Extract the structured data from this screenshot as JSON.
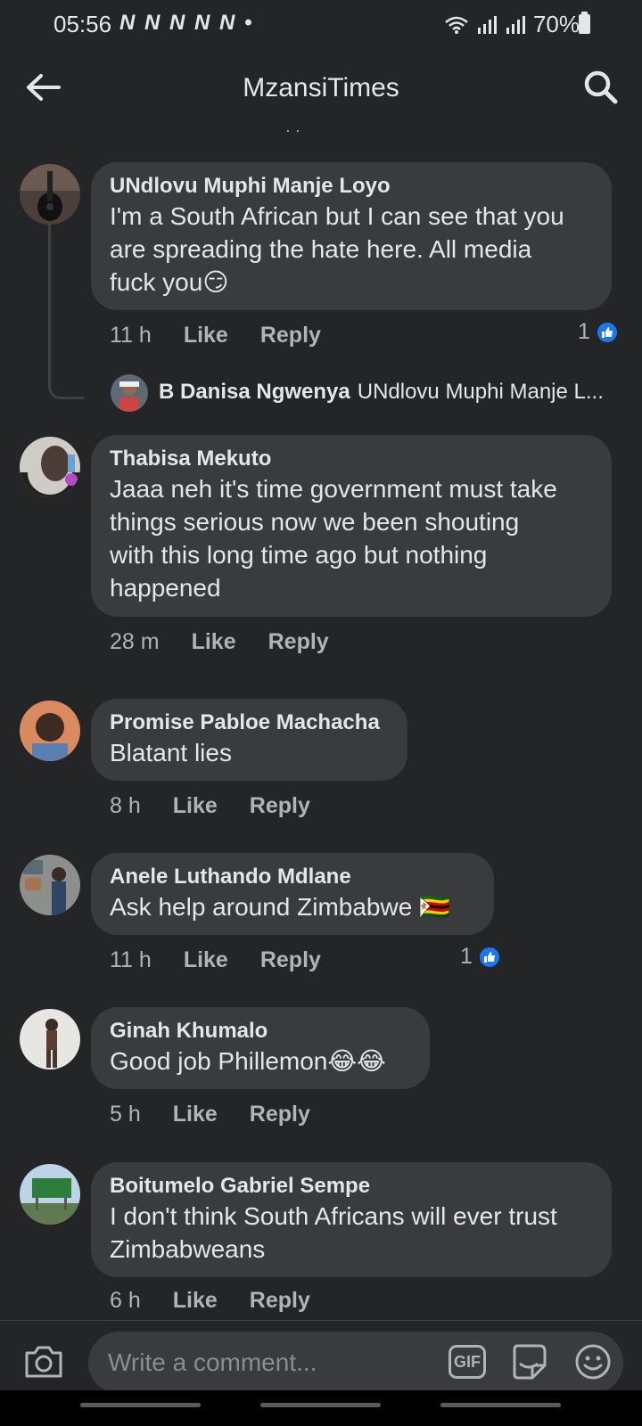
{
  "status_bar": {
    "time": "05:56",
    "notifications": "N N N N N •",
    "battery": "70%"
  },
  "header": {
    "title": "MzansiTimes"
  },
  "comments": [
    {
      "author": "UNdlovu Muphi Manje Loyo",
      "text_lines": [
        "I'm a South African but I can see that you",
        "are spreading the hate here. All media",
        "fuck you😏"
      ],
      "time": "11 h",
      "like": "Like",
      "reply": "Reply",
      "reactions": "1"
    },
    {
      "author": "Thabisa Mekuto",
      "text_lines": [
        "Jaaa neh it's time government must take",
        "things serious now we been shouting",
        "with this long time ago but  nothing",
        "happened"
      ],
      "time": "28 m",
      "like": "Like",
      "reply": "Reply"
    },
    {
      "author": "Promise Pabloe Machacha",
      "text_lines": [
        "Blatant lies"
      ],
      "time": "8 h",
      "like": "Like",
      "reply": "Reply"
    },
    {
      "author": "Anele Luthando Mdlane",
      "text_lines": [
        "Ask help around Zimbabwe 🇿🇼"
      ],
      "time": "11 h",
      "like": "Like",
      "reply": "Reply",
      "reactions": "1"
    },
    {
      "author": "Ginah Khumalo",
      "text_lines": [
        "Good job Phillemon😂😂"
      ],
      "time": "5 h",
      "like": "Like",
      "reply": "Reply"
    },
    {
      "author": "Boitumelo Gabriel Sempe",
      "text_lines": [
        "I don't think South Africans will ever trust",
        "Zimbabweans"
      ],
      "time": "6 h",
      "like": "Like",
      "reply": "Reply"
    }
  ],
  "reply_preview": {
    "author": "B Danisa Ngwenya",
    "text": "UNdlovu Muphi Manje L..."
  },
  "composer": {
    "placeholder": "Write a comment...",
    "gif_label": "GIF"
  },
  "colors": {
    "background": "#242526",
    "bubble": "#3a3b3c",
    "like_blue": "#1877f2"
  }
}
